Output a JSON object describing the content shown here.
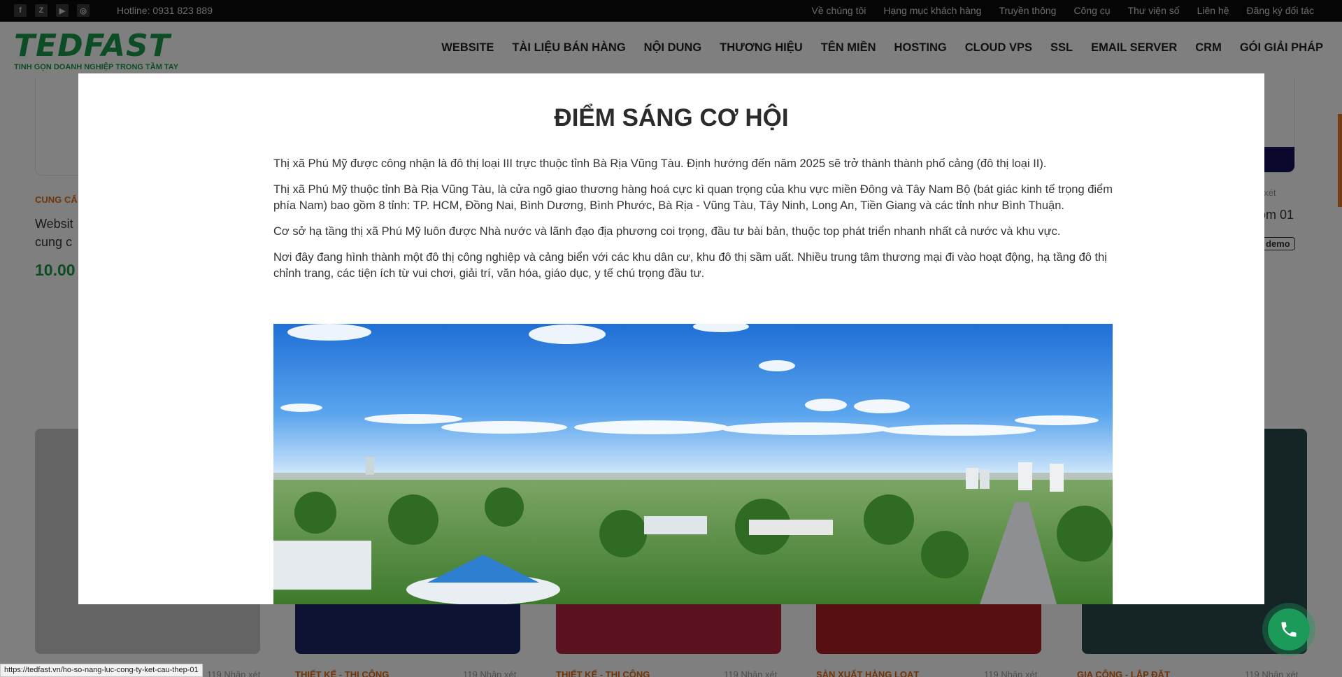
{
  "topbar": {
    "social_icons": [
      "facebook-icon",
      "zalo-icon",
      "youtube-icon",
      "instagram-icon"
    ],
    "social_glyphs": [
      "f",
      "Z",
      "▶",
      "◎"
    ],
    "hotline": "Hotline: 0931 823 889",
    "links": [
      "Về chúng tôi",
      "Hạng mục khách hàng",
      "Truyền thông",
      "Công cụ",
      "Thư viện số",
      "Liên hệ",
      "Đăng ký đối tác"
    ]
  },
  "header": {
    "logo_text": "TEDFAST",
    "slogan": "TINH GỌN DOANH NGHIỆP TRONG TẦM TAY",
    "nav": [
      "WEBSITE",
      "TÀI LIỆU BÁN HÀNG",
      "NỘI DUNG",
      "THƯƠNG HIỆU",
      "TÊN MIỀN",
      "HOSTING",
      "CLOUD VPS",
      "SSL",
      "EMAIL SERVER",
      "CRM",
      "GÓI GIẢI PHÁP"
    ]
  },
  "background": {
    "left_category": "CUNG CẤ",
    "left_title": "Websit cung c",
    "left_price": "10.00",
    "right_reviews": "hận xét",
    "right_title": "om 01",
    "right_demo": "demo",
    "products": [
      {
        "category": "",
        "reviews": "119 Nhận xét"
      },
      {
        "category": "THIẾT KẾ - THI CÔNG",
        "reviews": "119 Nhận xét"
      },
      {
        "category": "THIẾT KẾ - THI CÔNG",
        "reviews": "119 Nhận xét"
      },
      {
        "category": "SẢN XUẤT HÀNG LOẠT",
        "reviews": "119 Nhận xét"
      },
      {
        "category": "GIA CÔNG - LẮP ĐẶT",
        "reviews": "119 Nhận xét"
      }
    ]
  },
  "modal": {
    "title": "ĐIỂM SÁNG CƠ HỘI",
    "paragraphs": [
      "Thị xã Phú Mỹ được công nhận là đô thị loại III trực thuộc tỉnh Bà Rịa Vũng Tàu. Định hướng đến năm 2025 sẽ trở thành thành phố cảng (đô thị loại II).",
      "Thị xã Phú Mỹ thuộc tỉnh Bà Rịa Vũng Tàu, là cửa ngõ giao thương hàng hoá cực kì quan trọng của khu vực miền Đông và Tây Nam Bộ (bát giác kinh tế trọng điểm phía Nam) bao gồm 8 tỉnh: TP. HCM, Đồng Nai, Bình Dương, Bình Phước, Bà Rịa - Vũng Tàu, Tây Ninh, Long An, Tiền Giang và các tỉnh như Bình Thuận.",
      "Cơ sở hạ tầng thị xã Phú Mỹ luôn được Nhà nước và lãnh đạo địa phương coi trọng, đầu tư bài bản, thuộc top phát triển nhanh nhất cả nước và khu vực.",
      "Nơi đây đang hình thành một đô thị công nghiệp và cảng biển với các khu dân cư, khu đô thị sầm uất. Nhiều trung tâm thương mại đi vào hoạt động, hạ tầng đô thị chỉnh trang, các tiện ích từ vui chơi, giải trí, văn hóa, giáo dục, y tế chú trọng đầu tư."
    ],
    "image": "aerial-city-photo"
  },
  "status_url": "https://tedfast.vn/ho-so-nang-luc-cong-ty-ket-cau-thep-01",
  "phone_button_icon": "phone-icon",
  "colors": {
    "brand_green": "#1a9a4a",
    "accent_orange": "#e06a17",
    "topbar_bg": "#0b0b0b",
    "overlay": "rgba(0,0,0,0.5)"
  }
}
